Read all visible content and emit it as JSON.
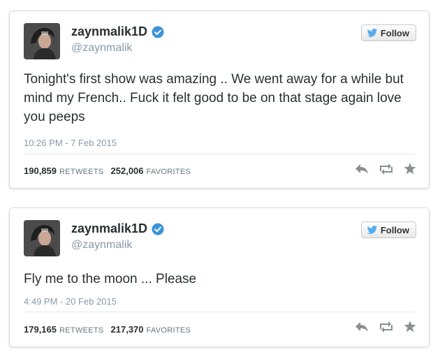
{
  "tweets": [
    {
      "name": "zaynmalik1D",
      "handle": "@zaynmalik",
      "follow_label": "Follow",
      "text": "Tonight's first show was amazing .. We went away for a while but mind my French.. Fuck it felt good to be on that stage again love you peeps",
      "timestamp": "10:26 PM - 7 Feb 2015",
      "retweets": "190,859",
      "retweets_label": "RETWEETS",
      "favorites": "252,006",
      "favorites_label": "FAVORITES"
    },
    {
      "name": "zaynmalik1D",
      "handle": "@zaynmalik",
      "follow_label": "Follow",
      "text": "Fly me to the moon ... Please",
      "timestamp": "4:49 PM - 20 Feb 2015",
      "retweets": "179,165",
      "retweets_label": "RETWEETS",
      "favorites": "217,370",
      "favorites_label": "FAVORITES"
    }
  ],
  "colors": {
    "verified": "#3b94d9",
    "twitter_blue": "#55acee",
    "action_gray": "#8a8f94"
  },
  "icons": [
    "avatar-photo",
    "verified-badge-icon",
    "twitter-bird-icon",
    "reply-icon",
    "retweet-icon",
    "favorite-star-icon"
  ]
}
